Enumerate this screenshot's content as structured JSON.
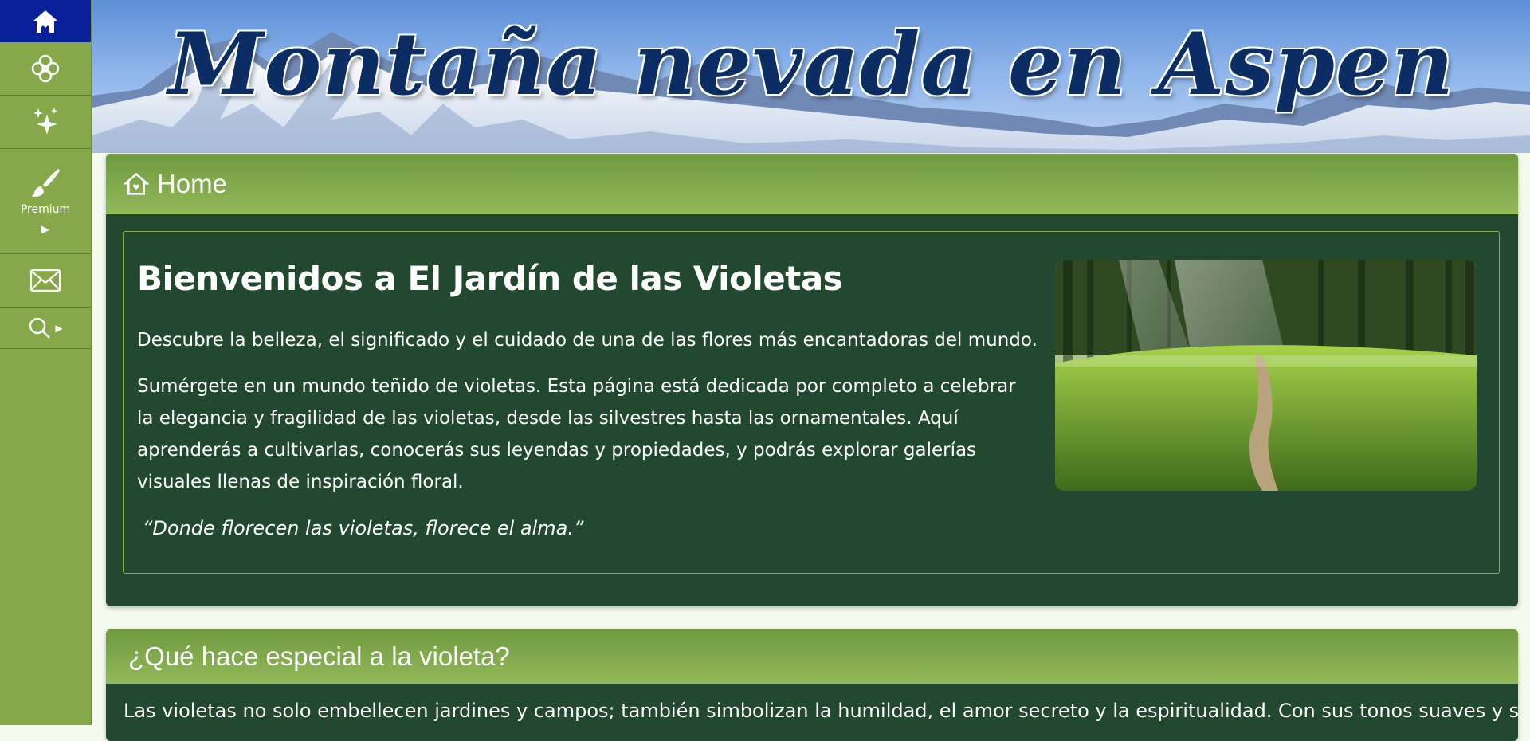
{
  "sidebar": {
    "items": [
      {
        "icon": "home-icon",
        "label": ""
      },
      {
        "icon": "flower-icon",
        "label": ""
      },
      {
        "icon": "sparkles-icon",
        "label": ""
      },
      {
        "icon": "brush-icon",
        "label": "Premium"
      },
      {
        "icon": "mail-icon",
        "label": ""
      },
      {
        "icon": "search-icon",
        "label": ""
      }
    ]
  },
  "banner": {
    "title": "Montaña nevada en Aspen"
  },
  "home_panel": {
    "header": "Home",
    "title": "Bienvenidos a El Jardín de las Violetas",
    "lead": "Descubre la belleza, el significado y el cuidado de una de las flores más encantadoras del mundo.",
    "body": "Sumérgete en un mundo teñido de violetas. Esta página está dedicada por completo a celebrar la elegancia y fragilidad de las violetas, desde las silvestres hasta las ornamentales. Aquí aprenderás a cultivarlas, conocerás sus leyendas y propiedades, y podrás explorar galerías visuales llenas de inspiración floral.",
    "quote": "“Donde florecen las violetas, florece el alma.”"
  },
  "special_panel": {
    "header": "¿Qué hace especial a la violeta?",
    "text": "Las violetas no solo embellecen jardines y campos; también simbolizan la humildad, el amor secreto y la espiritualidad. Con sus tonos suaves y su"
  },
  "colors": {
    "sidebar": "#86a84a",
    "sidebar_active": "#0a1f9a",
    "panel_body": "#234830",
    "panel_header": "#93b85a",
    "banner_title": "#0b2d63"
  }
}
